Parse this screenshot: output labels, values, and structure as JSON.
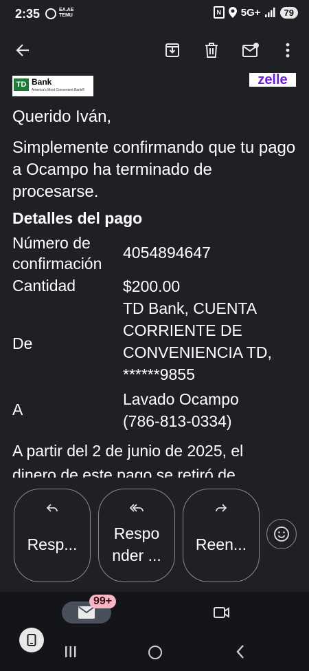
{
  "status_bar": {
    "time": "2:35",
    "temu_label_line1": "ΕΑ.ΑΕ",
    "temu_label_line2": "TEMU",
    "nfc_glyph": "N",
    "network": "5G+",
    "battery": "79"
  },
  "toolbar": {
    "icons": [
      "back-arrow-icon",
      "archive-icon",
      "delete-icon",
      "mark-unread-icon",
      "more-vert-icon"
    ]
  },
  "email": {
    "td_logo": {
      "mark": "TD",
      "name": "Bank",
      "tagline": "America's Most Convenient Bank®"
    },
    "zelle_logo": "zelle",
    "greeting": "Querido Iván,",
    "intro": "Simplemente confirmando que tu pago a Ocampo ha terminado de procesarse.",
    "details_title": "Detalles del pago",
    "details": {
      "confirmation_label_1": "Número de",
      "confirmation_label_2": "confirmación",
      "confirmation_value": "4054894647",
      "amount_label": "Cantidad",
      "amount_value": "$200.00",
      "from_label": "De",
      "from_value_1": "TD Bank, CUENTA",
      "from_value_2": "CORRIENTE DE",
      "from_value_3": "CONVENIENCIA TD,",
      "from_value_4": "******9855",
      "to_label": "A",
      "to_value_1": "Lavado Ocampo",
      "to_value_2": "(786-813-0334)"
    },
    "tail_line_1": "A partir del 2 de junio de 2025, el",
    "tail_line_2": "dinero de este pago se retiró de"
  },
  "actions": {
    "reply_label": "Resp...",
    "reply_all_label_1": "Respo",
    "reply_all_label_2": "nder ...",
    "forward_label": "Reen..."
  },
  "bottom_nav": {
    "mail_badge": "99+"
  }
}
